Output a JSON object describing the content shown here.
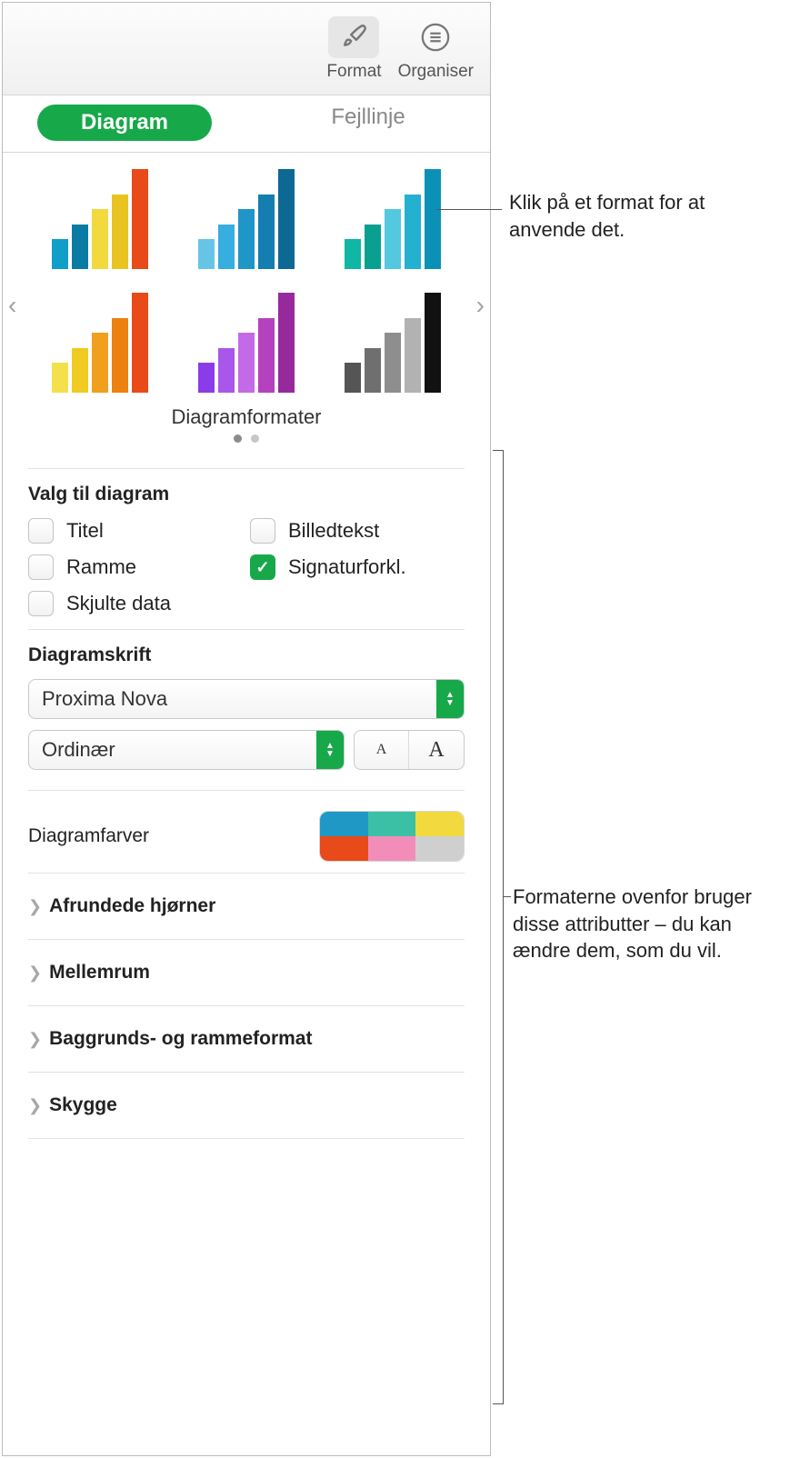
{
  "toolbar": {
    "format": "Format",
    "organize": "Organiser"
  },
  "tabs": {
    "diagram": "Diagram",
    "errorbar": "Fejllinje"
  },
  "styles": {
    "label": "Diagramformater"
  },
  "options": {
    "title_label": "Valg til diagram",
    "title": "Titel",
    "caption": "Billedtekst",
    "frame": "Ramme",
    "legend": "Signaturforkl.",
    "hidden_data": "Skjulte data"
  },
  "font": {
    "title_label": "Diagramskrift",
    "family": "Proxima Nova",
    "weight": "Ordinær"
  },
  "colors": {
    "label": "Diagramfarver"
  },
  "disclosures": {
    "rounded": "Afrundede hjørner",
    "spacing": "Mellemrum",
    "bgframe": "Baggrunds- og rammeformat",
    "shadow": "Skygge"
  },
  "callouts": {
    "apply": "Klik på et format for at anvende det.",
    "attrs": "Formaterne ovenfor bruger disse attributter – du kan ændre dem, som du vil."
  }
}
